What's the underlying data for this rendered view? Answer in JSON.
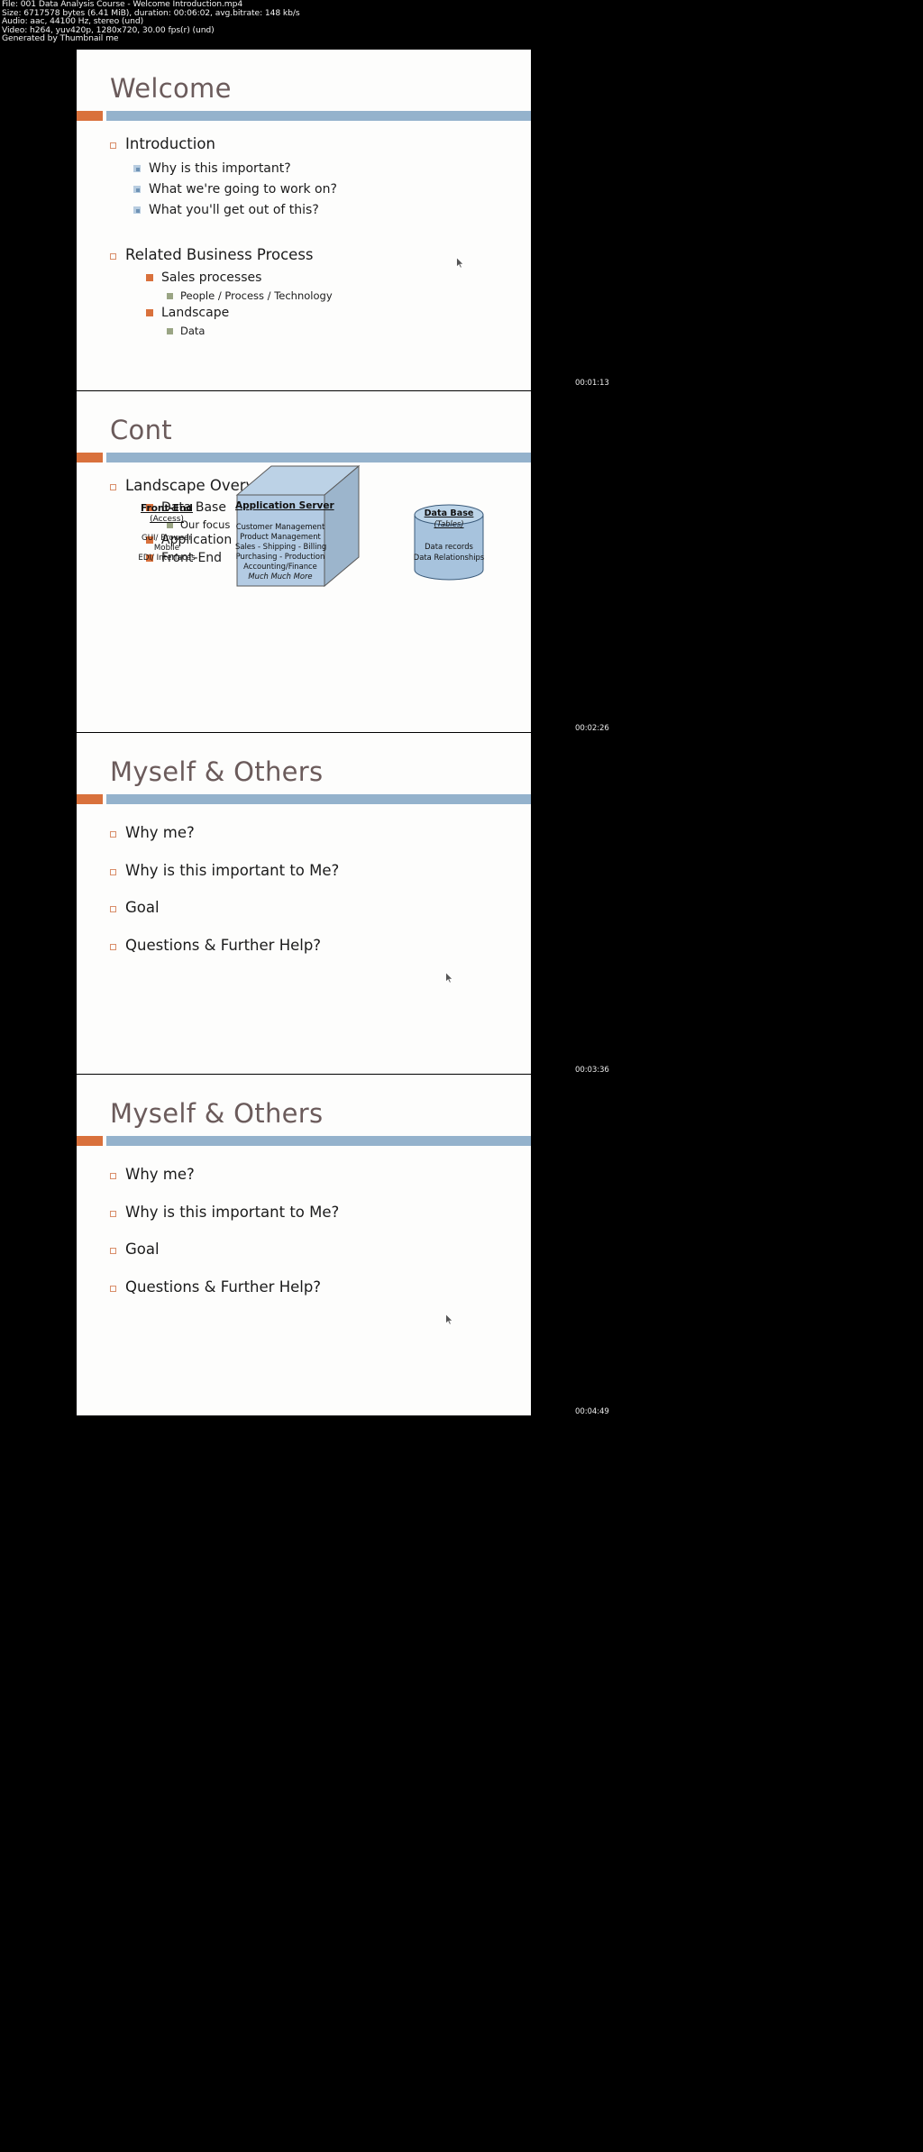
{
  "meta": {
    "lines": [
      "File: 001 Data Analysis Course - Welcome  Introduction.mp4",
      "Size: 6717578 bytes (6.41 MiB), duration: 00:06:02, avg.bitrate: 148 kb/s",
      "Audio: aac, 44100 Hz, stereo (und)",
      "Video: h264, yuv420p, 1280x720, 30.00 fps(r) (und)",
      "Generated by Thumbnail me"
    ]
  },
  "colors": {
    "accent_orange": "#d9713c",
    "accent_blue": "#94b2cc",
    "title_gray": "#6b5b5b",
    "bullet_green": "#9aa584",
    "background": "#000000",
    "slide_background": "#fdfdfc"
  },
  "timestamps": [
    "00:01:13",
    "00:02:26",
    "00:03:36",
    "00:04:49"
  ],
  "slides": [
    {
      "title": "Welcome",
      "bullets": [
        {
          "level": 1,
          "marker": "orange-hollow-square",
          "text": "Introduction"
        },
        {
          "level": 2,
          "marker": "blue-square",
          "text": "Why is this important?"
        },
        {
          "level": 2,
          "marker": "blue-square",
          "text": "What we're going to work on?"
        },
        {
          "level": 2,
          "marker": "blue-square",
          "text": "What you'll get out of this?"
        },
        {
          "level": 1,
          "marker": "orange-hollow-square",
          "text": "Related Business Process"
        },
        {
          "level": 2,
          "marker": "orange-square",
          "text": "Sales processes"
        },
        {
          "level": 3,
          "marker": "green-square",
          "text": "People / Process / Technology"
        },
        {
          "level": 2,
          "marker": "orange-square",
          "text": "Landscape"
        },
        {
          "level": 3,
          "marker": "green-square",
          "text": "Data"
        }
      ]
    },
    {
      "title": "Cont",
      "bullets": [
        {
          "level": 1,
          "marker": "orange-hollow-square",
          "text": "Landscape Overview"
        },
        {
          "level": 2,
          "marker": "orange-square",
          "text": "Data Base"
        },
        {
          "level": 3,
          "marker": "green-square",
          "text": "Our focus"
        },
        {
          "level": 2,
          "marker": "orange-square",
          "text": "Application Server"
        },
        {
          "level": 2,
          "marker": "orange-square",
          "text": "Front-End"
        }
      ],
      "diagram": {
        "front_end": {
          "title": "Front-End",
          "subtitle": "(Access)",
          "items": [
            "GUI/ Browser",
            "Mobile",
            "EDI/ Interfaces"
          ]
        },
        "application_server": {
          "title": "Application Server",
          "items": [
            "Customer Management",
            "Product Management",
            "Sales - Shipping - Billing",
            "Purchasing - Production",
            "Accounting/Finance",
            "Much Much More"
          ]
        },
        "data_base": {
          "title": "Data Base",
          "subtitle": "(Tables)",
          "items": [
            "Data records",
            "Data Relationships"
          ]
        }
      }
    },
    {
      "title": "Myself & Others",
      "bullets": [
        {
          "level": 1,
          "marker": "orange-hollow-square",
          "text": "Why me?"
        },
        {
          "level": 1,
          "marker": "orange-hollow-square",
          "text": "Why is this important to Me?"
        },
        {
          "level": 1,
          "marker": "orange-hollow-square",
          "text": "Goal"
        },
        {
          "level": 1,
          "marker": "orange-hollow-square",
          "text": "Questions & Further Help?"
        }
      ]
    },
    {
      "title": "Myself & Others",
      "bullets": [
        {
          "level": 1,
          "marker": "orange-hollow-square",
          "text": "Why me?"
        },
        {
          "level": 1,
          "marker": "orange-hollow-square",
          "text": "Why is this important to Me?"
        },
        {
          "level": 1,
          "marker": "orange-hollow-square",
          "text": "Goal"
        },
        {
          "level": 1,
          "marker": "orange-hollow-square",
          "text": "Questions & Further Help?"
        }
      ]
    }
  ]
}
